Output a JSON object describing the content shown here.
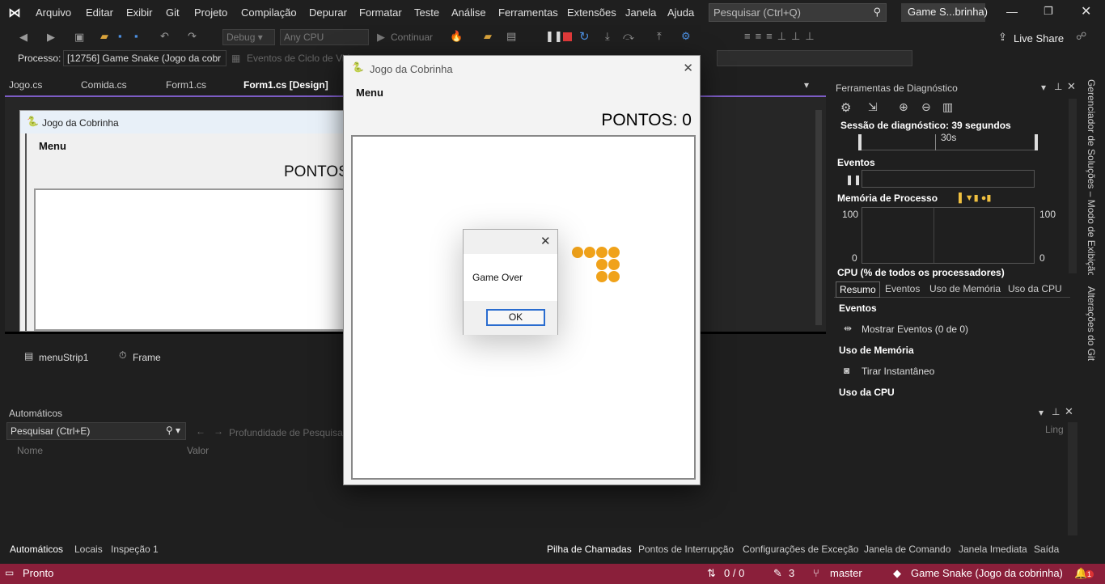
{
  "menu": [
    "Arquivo",
    "Editar",
    "Exibir",
    "Git",
    "Projeto",
    "Compilação",
    "Depurar",
    "Formatar",
    "Teste",
    "Análise",
    "Ferramentas",
    "Extensões",
    "Janela",
    "Ajuda"
  ],
  "search": {
    "placeholder": "Pesquisar (Ctrl+Q)"
  },
  "solution_badge": "Game S...brinha)",
  "toolbar": {
    "config": "Debug",
    "platform": "Any CPU",
    "continue": "Continuar",
    "live_share": "Live Share"
  },
  "toolbar2": {
    "process_label": "Processo:",
    "process_value": "[12756] Game Snake (Jogo da cobr",
    "events_label": "Eventos de Ciclo de Vida"
  },
  "tabs": [
    "Jogo.cs",
    "Comida.cs",
    "Form1.cs",
    "Form1.cs [Design]"
  ],
  "designer": {
    "title": "Jogo da Cobrinha",
    "menu": "Menu",
    "score": "PONTOS"
  },
  "tray": {
    "item1": "menuStrip1",
    "item2": "Frame"
  },
  "diag": {
    "title": "Ferramentas de Diagnóstico",
    "session": "Sessão de diagnóstico: 39 segundos",
    "timeline": "30s",
    "events": "Eventos",
    "memory": "Memória de Processo",
    "mem_left_top": "100",
    "mem_left_bottom": "0",
    "mem_right_top": "100",
    "mem_right_bottom": "0",
    "cpu": "CPU (% de todos os processadores)",
    "subtabs": [
      "Resumo",
      "Eventos",
      "Uso de Memória",
      "Uso da CPU"
    ],
    "sec_events": "Eventos",
    "show_events": "Mostrar Eventos (0 de 0)",
    "sec_memory": "Uso de Memória",
    "snapshot": "Tirar Instantâneo",
    "sec_cpu": "Uso da CPU"
  },
  "side": {
    "v1": "Gerenciador de Soluções – Modo de Exibição…",
    "v2": "Alterações do Git"
  },
  "auto": {
    "title": "Automáticos",
    "search": "Pesquisar (Ctrl+E)",
    "depth": "Profundidade de Pesquisa:",
    "col_name": "Nome",
    "col_value": "Valor",
    "tabs": [
      "Automáticos",
      "Locais",
      "Inspeção 1"
    ]
  },
  "calls": {
    "lang": "Ling",
    "tabs": [
      "Pilha de Chamadas",
      "Pontos de Interrupção",
      "Configurações de Exceção",
      "Janela de Comando",
      "Janela Imediata",
      "Saída"
    ]
  },
  "status": {
    "ready": "Pronto",
    "updown": "0 / 0",
    "edits": "3",
    "branch": "master",
    "project": "Game Snake (Jogo da cobrinha)",
    "notif": "1"
  },
  "game": {
    "title": "Jogo da Cobrinha",
    "menu": "Menu",
    "score": "PONTOS: 0",
    "snake_color": "#f0a21a"
  },
  "dialog": {
    "message": "Game Over",
    "ok": "OK"
  }
}
